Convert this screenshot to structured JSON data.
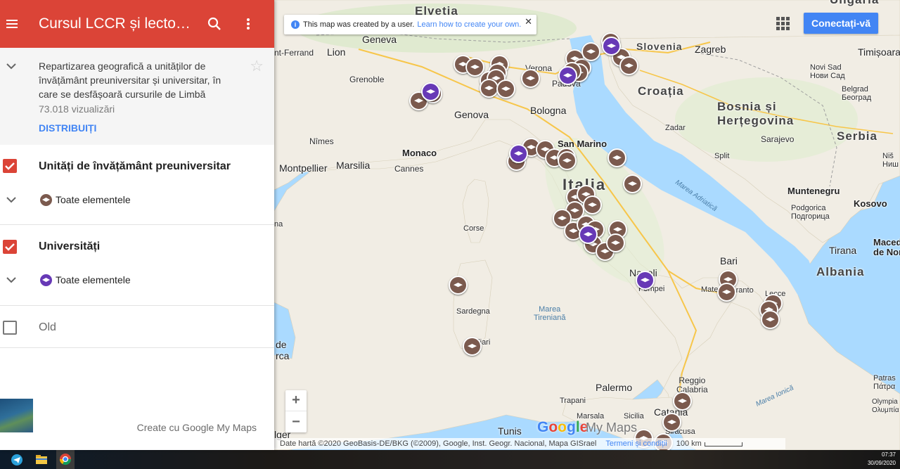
{
  "sidebar": {
    "title": "Cursul LCCR și lectoratele",
    "description": "Repartizarea geografică a unităților de învățământ preuniversitar și universitar, în care se desfășoară cursurile de Limbă",
    "views": "73.018 vizualizări",
    "share_label": "DISTRIBUIȚI",
    "layers": [
      {
        "title": "Unități de învățământ preuniversitar",
        "checked": true,
        "sub_label": "Toate elementele",
        "icon_color": "#7b5a4e"
      },
      {
        "title": "Universități",
        "checked": true,
        "sub_label": "Toate elementele",
        "icon_color": "#6739b6"
      },
      {
        "title": "Old",
        "checked": false
      }
    ],
    "created_with": "Create cu Google My Maps"
  },
  "map": {
    "info_banner": {
      "text": "This map was created by a user.",
      "link": "Learn how to create your own."
    },
    "signin_label": "Conectați-vă",
    "zoom_in": "+",
    "zoom_out": "−",
    "google_logo": "Google",
    "mymaps_logo": "My Maps",
    "attribution": "Date hartă ©2020 GeoBasis-DE/BKG (©2009), Google, Inst. Geogr. Nacional, Mapa GISrael",
    "terms": "Termeni și condiții",
    "scale": "100 km",
    "labels": {
      "helvetia": "Elvetia",
      "geneva": "Geneva",
      "lion": "Lion",
      "ferrand": "nt-Ferrand",
      "grenoble": "Grenoble",
      "verona": "Verona",
      "padova": "Padova",
      "slovenia": "Slovenia",
      "zagreb": "Zagreb",
      "timisoara": "Timișoara",
      "ungaria": "Ungaria",
      "croatia": "Croația",
      "novisad": "Novi Sad\nНови Сад",
      "belgrad": "Belgrad\nБеоград",
      "bosnia": "Bosnia și\nHerțegovina",
      "sarajevo": "Sarajevo",
      "serbia": "Serbia",
      "genova": "Genova",
      "bologna": "Bologna",
      "zadar": "Zadar",
      "nimes": "Nîmes",
      "monaco": "Monaco",
      "montpellier": "Montpellier",
      "marsilia": "Marsilia",
      "cannes": "Cannes",
      "sanmarino": "San Marino",
      "split": "Split",
      "italia": "Italia",
      "adriatica": "Marea Adriatică",
      "muntenegru": "Muntenegru",
      "kosovo": "Kosovo",
      "podgorica": "Podgorica\nПодгорица",
      "corse": "Corse",
      "tirana": "Tirana",
      "bari": "Bari",
      "macedonia": "Macedo\nde Nor",
      "albania": "Albania",
      "napoli": "Napoli",
      "pompei": "Pompei",
      "matera": "Matera",
      "taranto": "Taranto",
      "sardegna": "Sardegna",
      "tireniana": "Marea\nTireniană",
      "cagliari": "Cagliari",
      "lecce": "Lecce",
      "spain": "de\nrca",
      "palermo": "Palermo",
      "reggio": "Reggio\nCalabria",
      "trapani": "Trapani",
      "marsala": "Marsala",
      "sicilia": "Sicilia",
      "catania": "Catania",
      "ionica": "Marea Ionică",
      "patras": "Patras\nΠάτρα",
      "olympia": "Olympia\nΟλυμπία",
      "tunis": "Tunis",
      "alger": "lger",
      "siracusa": "Siracusa",
      "nis": "Niš\nНиш",
      "rca": "na"
    }
  },
  "taskbar": {
    "time": "07:37",
    "date": "30/09/2020"
  },
  "colors": {
    "header": "#db4437",
    "accent": "#4285f4",
    "school_pin": "#7b5a4e",
    "university_pin": "#6739b6",
    "sea": "#aadaff",
    "land": "#f1ede4"
  }
}
